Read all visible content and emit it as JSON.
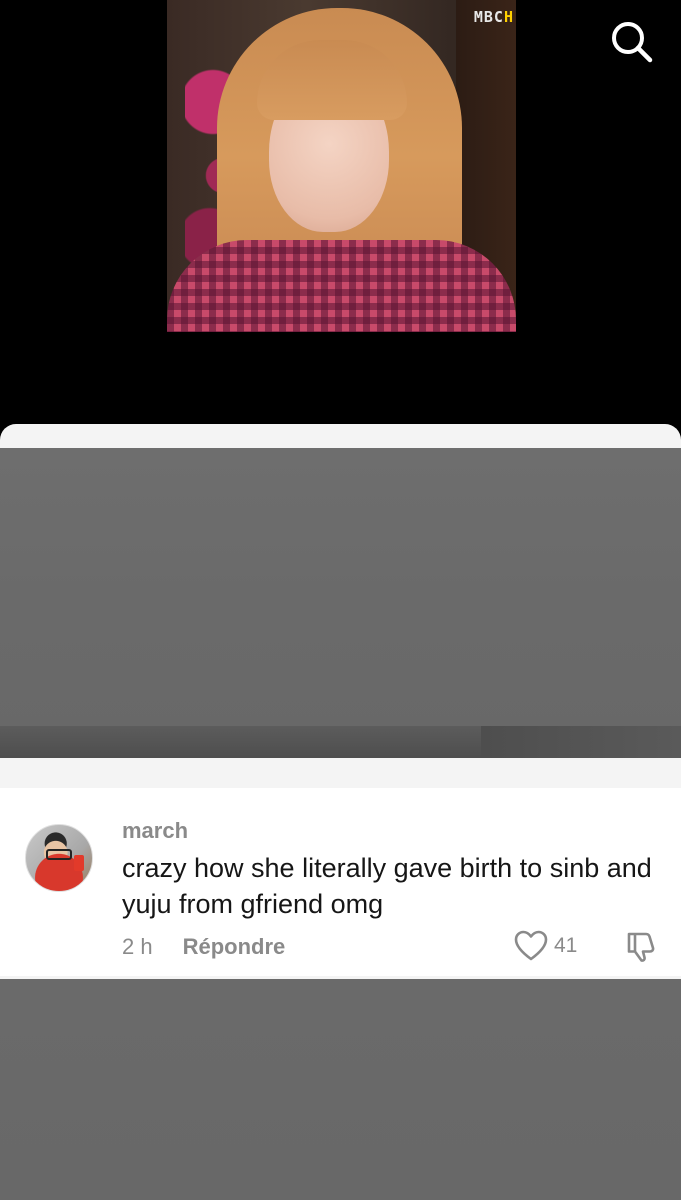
{
  "video": {
    "channel_logo_main": "MBC",
    "channel_logo_accent": "H"
  },
  "header": {
    "search_icon": "search-icon"
  },
  "comment": {
    "username": "march",
    "text": "crazy how she literally gave birth to sinb and yuju from gfriend omg",
    "time": "2 h",
    "reply_label": "Répondre",
    "like_count": "41",
    "like_icon": "heart-outline-icon",
    "dislike_icon": "thumbs-down-icon"
  },
  "colors": {
    "background": "#000000",
    "sheet": "#f4f4f4",
    "placeholder_gray": "#6a6a6a",
    "comment_bg": "#ffffff",
    "text_primary": "#161616",
    "text_secondary": "#8a8a8a"
  }
}
